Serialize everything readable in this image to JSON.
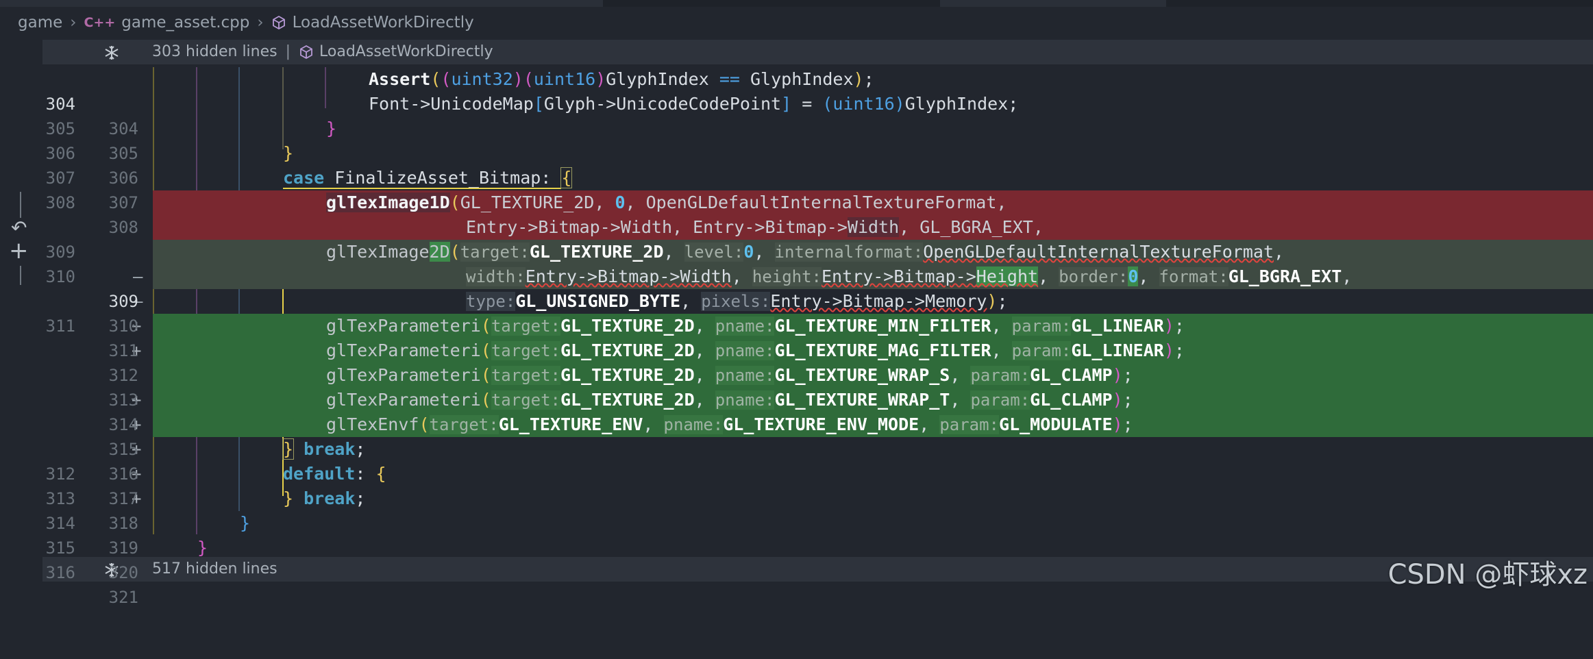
{
  "breadcrumb": {
    "items": [
      "game",
      "game_asset.cpp",
      "LoadAssetWorkDirectly"
    ],
    "lang_badge": "C++"
  },
  "folds": {
    "top": {
      "text": "303 hidden lines",
      "symbol": "LoadAssetWorkDirectly"
    },
    "bottom": {
      "text": "517 hidden lines"
    }
  },
  "lines": [
    {
      "old": "304",
      "new": "304",
      "sign": "",
      "type": "ctx",
      "current": true
    },
    {
      "old": "305",
      "new": "305",
      "sign": "",
      "type": "ctx"
    },
    {
      "old": "306",
      "new": "306",
      "sign": "",
      "type": "ctx"
    },
    {
      "old": "307",
      "new": "307",
      "sign": "",
      "type": "ctx"
    },
    {
      "old": "308",
      "new": "308",
      "sign": "",
      "type": "ctx"
    },
    {
      "old": "309",
      "new": "",
      "sign": "—",
      "type": "del"
    },
    {
      "old": "310",
      "new": "",
      "sign": "—",
      "type": "del"
    },
    {
      "old": "",
      "new": "309",
      "sign": "+",
      "type": "addmod",
      "current": true
    },
    {
      "old": "",
      "new": "310",
      "sign": "+",
      "type": "addmod"
    },
    {
      "old": "311",
      "new": "311",
      "sign": "",
      "type": "ctx"
    },
    {
      "old": "",
      "new": "312",
      "sign": "+",
      "type": "add"
    },
    {
      "old": "",
      "new": "313",
      "sign": "+",
      "type": "add"
    },
    {
      "old": "",
      "new": "314",
      "sign": "+",
      "type": "add"
    },
    {
      "old": "",
      "new": "315",
      "sign": "+",
      "type": "add"
    },
    {
      "old": "",
      "new": "316",
      "sign": "+",
      "type": "add"
    },
    {
      "old": "312",
      "new": "317",
      "sign": "",
      "type": "ctx"
    },
    {
      "old": "313",
      "new": "318",
      "sign": "",
      "type": "ctx"
    },
    {
      "old": "314",
      "new": "319",
      "sign": "",
      "type": "ctx"
    },
    {
      "old": "315",
      "new": "320",
      "sign": "",
      "type": "ctx"
    },
    {
      "old": "316",
      "new": "321",
      "sign": "",
      "type": "ctx"
    }
  ],
  "code": {
    "l304": {
      "fn": "Assert",
      "p1": "(",
      "p2": "(",
      "t1": "uint32",
      "p3": ")",
      "p4": "(",
      "t2": "uint16",
      "p5": ")",
      "rest1": "GlyphIndex ",
      "op": "==",
      "rest2": " GlyphIndex",
      "p6": ")",
      "end": ";"
    },
    "l305": {
      "a": "Font->UnicodeMap",
      "b1": "[",
      "b": "Glyph->UnicodeCodePoint",
      "b2": "]",
      "c": " = ",
      "p1": "(",
      "t": "uint16",
      "p2": ")",
      "d": "GlyphIndex;"
    },
    "l306": {
      "brace": "}"
    },
    "l307": {
      "brace": "}"
    },
    "l308": {
      "kw": "case",
      "label": " FinalizeAsset_Bitmap: ",
      "brace": "{"
    },
    "l309d": {
      "fn": "glTexImage1D",
      "p": "(",
      "a": "GL_TEXTURE_2D, ",
      "n": "0",
      "b": ", OpenGLDefaultInternalTextureFormat,"
    },
    "l310d": {
      "a": "Entry->Bitmap->Width, Entry->Bitmap->",
      "b": "Width",
      "c": ", GL_BGRA_EXT,"
    },
    "l309a": {
      "fn1": "glTexImage",
      "fn2": "2D",
      "p": "(",
      "h1": "target:",
      "a1": "GL_TEXTURE_2D",
      "s1": ", ",
      "h2": "level:",
      "n": "0",
      "s2": ", ",
      "h3": "internalformat:",
      "a3": "OpenGLDefaultInternalTextureFormat",
      "s3": ","
    },
    "l310a": {
      "h1": "width:",
      "a1": "Entry->Bitmap->Width",
      "s1": ", ",
      "h2": "height:",
      "a2a": "Entry->Bitmap->",
      "a2b": "Height",
      "s2": ", ",
      "h3": "border:",
      "n": "0",
      "s3": ", ",
      "h4": "format:",
      "a4": "GL_BGRA_EXT",
      "s4": ","
    },
    "l311": {
      "h1": "type:",
      "a1": "GL_UNSIGNED_BYTE",
      "s1": ", ",
      "h2": "pixels:",
      "a2": "Entry->Bitmap->Memory",
      "p": ")",
      "end": ";"
    },
    "l312": {
      "fn": "glTexParameteri",
      "p": "(",
      "h1": "target:",
      "a1": "GL_TEXTURE_2D",
      "s1": ", ",
      "h2": "pname:",
      "a2": "GL_TEXTURE_MIN_FILTER",
      "s2": ", ",
      "h3": "param:",
      "a3": "GL_LINEAR",
      "pe": ")",
      "end": ";"
    },
    "l313": {
      "fn": "glTexParameteri",
      "p": "(",
      "h1": "target:",
      "a1": "GL_TEXTURE_2D",
      "s1": ", ",
      "h2": "pname:",
      "a2": "GL_TEXTURE_MAG_FILTER",
      "s2": ", ",
      "h3": "param:",
      "a3": "GL_LINEAR",
      "pe": ")",
      "end": ";"
    },
    "l314": {
      "fn": "glTexParameteri",
      "p": "(",
      "h1": "target:",
      "a1": "GL_TEXTURE_2D",
      "s1": ", ",
      "h2": "pname:",
      "a2": "GL_TEXTURE_WRAP_S",
      "s2": ", ",
      "h3": "param:",
      "a3": "GL_CLAMP",
      "pe": ")",
      "end": ";"
    },
    "l315": {
      "fn": "glTexParameteri",
      "p": "(",
      "h1": "target:",
      "a1": "GL_TEXTURE_2D",
      "s1": ", ",
      "h2": "pname:",
      "a2": "GL_TEXTURE_WRAP_T",
      "s2": ", ",
      "h3": "param:",
      "a3": "GL_CLAMP",
      "pe": ")",
      "end": ";"
    },
    "l316": {
      "fn": "glTexEnvf",
      "p": "(",
      "h1": "target:",
      "a1": "GL_TEXTURE_ENV",
      "s1": ", ",
      "h2": "pname:",
      "a2": "GL_TEXTURE_ENV_MODE",
      "s2": ", ",
      "h3": "param:",
      "a3": "GL_MODULATE",
      "pe": ")",
      "end": ";"
    },
    "l317": {
      "brace": "}",
      "kw": " break",
      "end": ";"
    },
    "l318": {
      "kw": "default",
      "c": ": ",
      "brace": "{"
    },
    "l319": {
      "brace": "}",
      "kw": " break",
      "end": ";"
    },
    "l320": {
      "brace": "}"
    },
    "l321": {
      "brace": "}"
    }
  },
  "watermark": "CSDN @虾球xz",
  "colors": {
    "background": "#22262e",
    "deleted": "#7a2830",
    "added": "#2f6b3a",
    "keyword": "#4fa3c7",
    "type": "#4ea0e2"
  }
}
